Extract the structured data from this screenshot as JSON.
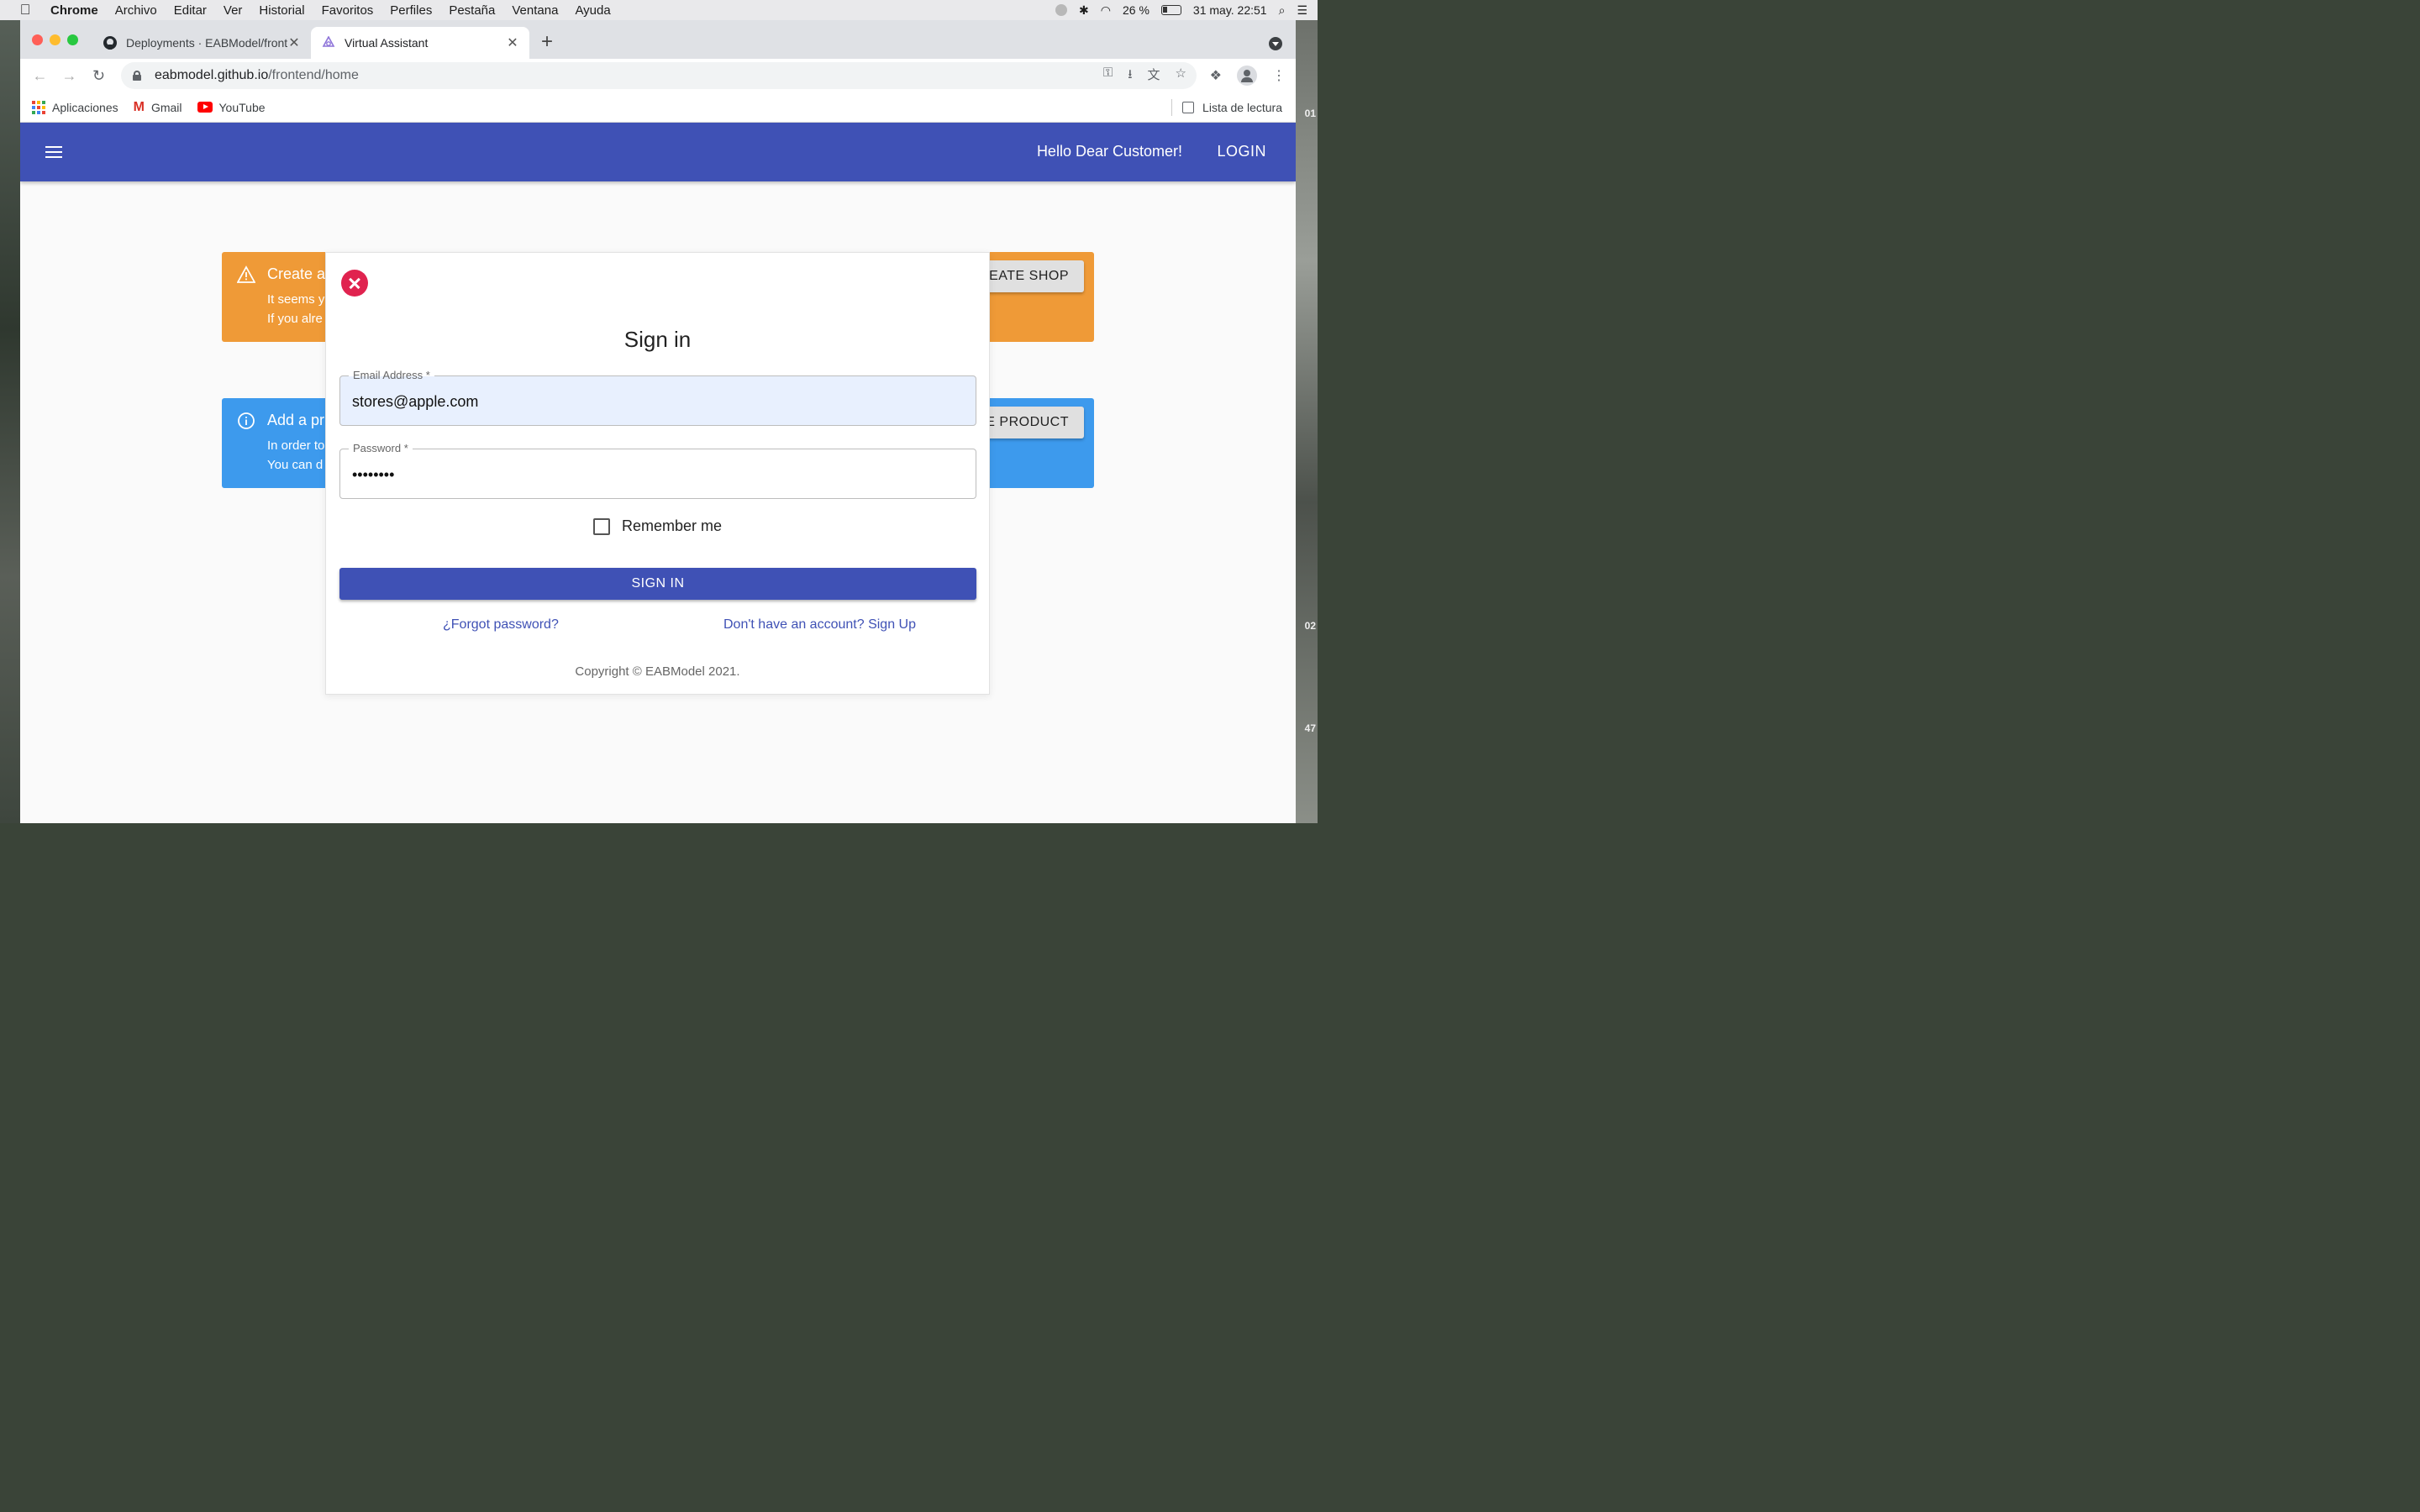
{
  "menubar": {
    "app": "Chrome",
    "items": [
      "Archivo",
      "Editar",
      "Ver",
      "Historial",
      "Favoritos",
      "Perfiles",
      "Pestaña",
      "Ventana",
      "Ayuda"
    ],
    "battery": "26 %",
    "datetime": "31 may.  22:51"
  },
  "desktop": {
    "labels": [
      "01",
      "02",
      "47"
    ]
  },
  "tabs": [
    {
      "title": "Deployments · EABModel/frontend",
      "icon": "github-icon"
    },
    {
      "title": "Virtual Assistant",
      "icon": "assistant-icon",
      "active": true
    }
  ],
  "address": {
    "host": "eabmodel.github.io",
    "path": "/frontend/home"
  },
  "bookmarks": {
    "apps": "Aplicaciones",
    "gmail": "Gmail",
    "youtube": "YouTube",
    "reading_list": "Lista de lectura"
  },
  "appbar": {
    "greeting": "Hello Dear Customer!",
    "login": "LOGIN",
    "color": "#3f51b5"
  },
  "alerts": {
    "shop": {
      "title": "Create a",
      "line1": "It seems y",
      "line2": "If you alre",
      "button": "CREATE SHOP",
      "color": "#ef9a37"
    },
    "product": {
      "title": "Add a pr",
      "line1": "In order to",
      "line2": "You can d",
      "button": "CREATE PRODUCT",
      "color": "#3d9aed"
    }
  },
  "dialog": {
    "title": "Sign in",
    "email_label": "Email Address *",
    "email_value": "stores@apple.com",
    "password_label": "Password *",
    "password_value": "••••••••",
    "remember": "Remember me",
    "remember_checked": false,
    "submit": "SIGN IN",
    "forgot": "¿Forgot password?",
    "signup": "Don't have an account? Sign Up",
    "copyright": "Copyright © EABModel 2021."
  }
}
